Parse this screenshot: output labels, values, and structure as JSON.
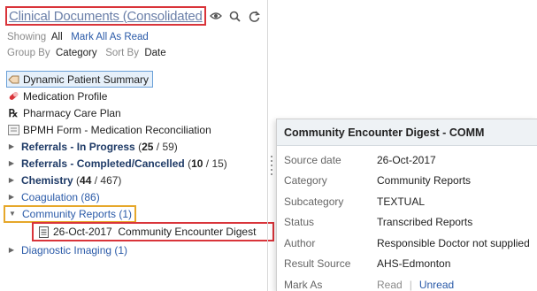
{
  "header": {
    "title": "Clinical Documents (Consolidated",
    "icons": [
      "eye-icon",
      "search-icon",
      "refresh-icon"
    ]
  },
  "filters": {
    "showing_label": "Showing",
    "showing_value": "All",
    "mark_all_label": "Mark All As Read",
    "group_by_label": "Group By",
    "group_by_value": "Category",
    "sort_by_label": "Sort By",
    "sort_by_value": "Date"
  },
  "tree": {
    "dynamic_summary": "Dynamic Patient Summary",
    "medication_profile": "Medication Profile",
    "pharmacy_care_plan": "Pharmacy Care Plan",
    "bpmh": "BPMH Form - Medication Reconciliation",
    "referrals_in_progress": {
      "label": "Referrals - In Progress",
      "open": "(",
      "unread": "25",
      "sep": " / ",
      "total": "59)"
    },
    "referrals_completed": {
      "label": "Referrals - Completed/Cancelled",
      "open": "(",
      "unread": "10",
      "sep": " / ",
      "total": "15)"
    },
    "chemistry": {
      "label": "Chemistry",
      "open": "(",
      "unread": "44",
      "sep": " / ",
      "total": "467)"
    },
    "coagulation": "Coagulation (86)",
    "community_reports": "Community Reports (1)",
    "community_doc": "26-Oct-2017  Community Encounter Digest",
    "diagnostic_imaging": "Diagnostic Imaging (1)"
  },
  "card": {
    "title": "Community Encounter Digest - COMM",
    "rows": [
      {
        "key": "Source date",
        "value": "26-Oct-2017"
      },
      {
        "key": "Category",
        "value": "Community Reports"
      },
      {
        "key": "Subcategory",
        "value": "TEXTUAL"
      },
      {
        "key": "Status",
        "value": "Transcribed Reports"
      },
      {
        "key": "Author",
        "value": "Responsible Doctor not supplied"
      },
      {
        "key": "Result Source",
        "value": "AHS-Edmonton"
      }
    ],
    "mark_as_label": "Mark As",
    "read_label": "Read",
    "unread_label": "Unread"
  },
  "colors": {
    "highlight_red": "#d9343a",
    "highlight_yellow": "#e6a72a",
    "link_blue": "#2a5aa8",
    "bold_navy": "#1e3a66"
  }
}
